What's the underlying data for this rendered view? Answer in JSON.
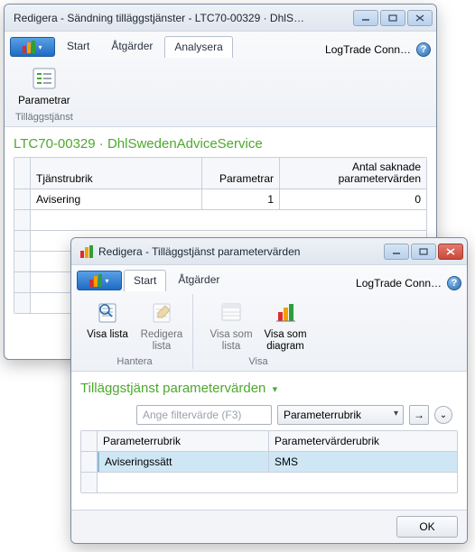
{
  "parent_window": {
    "title": "Redigera - Sändning tilläggstjänster - LTC70-00329 · DhlS…",
    "tabs": {
      "start": "Start",
      "actions": "Åtgärder",
      "analyze": "Analysera"
    },
    "active_tab": "analyze",
    "logtrade_label": "LogTrade Conn…",
    "ribbon": {
      "parametrar_label": "Parametrar",
      "group1_label": "Tilläggstjänst"
    },
    "heading": "LTC70-00329 · DhlSwedenAdviceService",
    "grid": {
      "columns": {
        "service_heading": "Tjänstrubrik",
        "parameters": "Parametrar",
        "missing": "Antal saknade parametervärden"
      },
      "rows": [
        {
          "service_heading": "Avisering",
          "parameters": 1,
          "missing": 0
        }
      ]
    }
  },
  "child_window": {
    "title": "Redigera - Tilläggstjänst parametervärden",
    "tabs": {
      "start": "Start",
      "actions": "Åtgärder"
    },
    "active_tab": "start",
    "logtrade_label": "LogTrade Conn…",
    "ribbon": {
      "view_list": "Visa lista",
      "edit_list": "Redigera lista",
      "show_as_list": "Visa som lista",
      "show_as_chart": "Visa som diagram",
      "group_manage": "Hantera",
      "group_view": "Visa"
    },
    "heading": "Tilläggstjänst parametervärden",
    "filter": {
      "placeholder": "Ange filtervärde (F3)",
      "dropdown_value": "Parameterrubrik"
    },
    "grid": {
      "columns": {
        "param_heading": "Parameterrubrik",
        "param_value_heading": "Parametervärderubrik"
      },
      "rows": [
        {
          "param_heading": "Aviseringssätt",
          "param_value_heading": "SMS"
        }
      ]
    },
    "ok_label": "OK"
  },
  "icons": {
    "dynamics_logo": "dynamics-logo"
  }
}
